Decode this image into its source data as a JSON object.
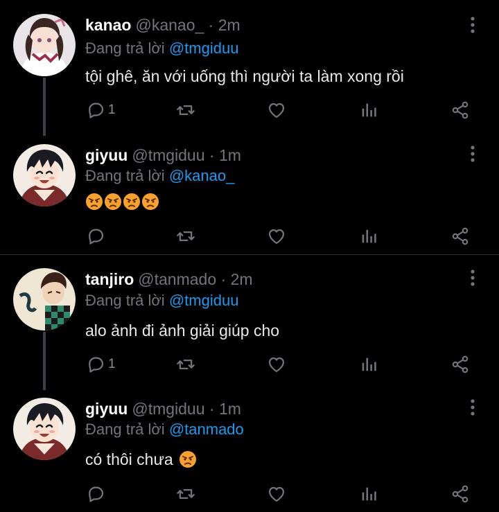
{
  "colors": {
    "background": "#000000",
    "muted": "#71767b",
    "mention": "#1d9bf0",
    "text": "#e7e9ea"
  },
  "tweets": [
    {
      "name": "kanao",
      "handle": "@kanao_ · 2m",
      "reply_prefix": "Đang trả lời",
      "reply_to": "@tmgiduu",
      "text": "tội ghê, ăn với uống thì người ta làm xong rồi",
      "emojis": [],
      "reply_count": "1",
      "avatar": "anime-girl-avatar"
    },
    {
      "name": "giyuu",
      "handle": "@tmgiduu · 1m",
      "reply_prefix": "Đang trả lời",
      "reply_to": "@kanao_",
      "text": "",
      "emojis": [
        "angry-face",
        "angry-face",
        "angry-face",
        "angry-face"
      ],
      "reply_count": "",
      "avatar": "anime-boy-smiling-avatar"
    },
    {
      "name": "tanjiro",
      "handle": "@tanmado · 2m",
      "reply_prefix": "Đang trả lời",
      "reply_to": "@tmgiduu",
      "text": "alo ảnh đi ảnh giải giúp cho",
      "emojis": [],
      "reply_count": "1",
      "avatar": "anime-boy-checkered-avatar"
    },
    {
      "name": "giyuu",
      "handle": "@tmgiduu · 1m",
      "reply_prefix": "Đang trả lời",
      "reply_to": "@tanmado",
      "text": "có thôi chưa",
      "emojis": [
        "angry-face"
      ],
      "reply_count": "",
      "avatar": "anime-boy-smiling-avatar"
    }
  ],
  "icons": [
    "reply-icon",
    "retweet-icon",
    "like-icon",
    "views-icon",
    "share-icon",
    "more-icon"
  ]
}
